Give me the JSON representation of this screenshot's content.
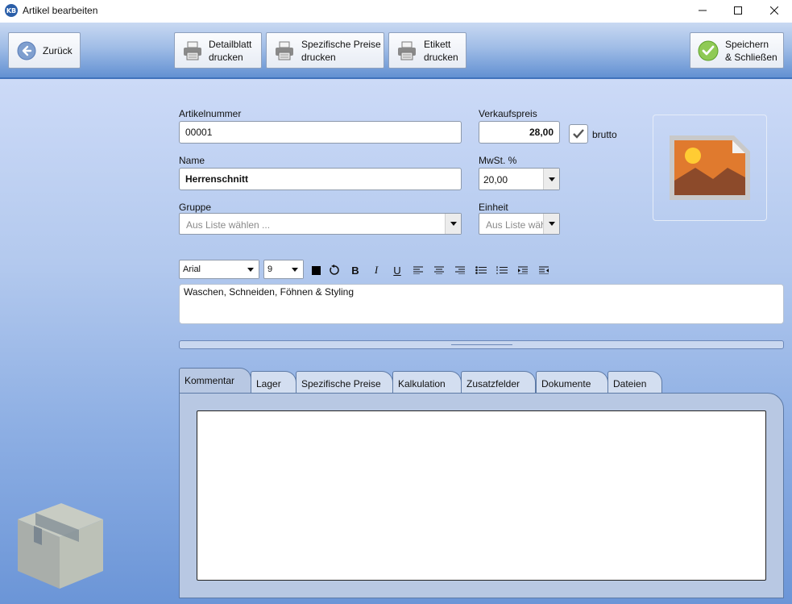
{
  "window": {
    "title": "Artikel bearbeiten",
    "app_icon": "KB",
    "controls": [
      "minimize-icon",
      "maximize-icon",
      "close-icon"
    ]
  },
  "toolbar": {
    "back_label": "Zurück",
    "print_detail_label": [
      "Detailblatt",
      "drucken"
    ],
    "print_prices_label": [
      "Spezifische Preise",
      "drucken"
    ],
    "print_label_label": [
      "Etikett",
      "drucken"
    ],
    "save_close_label": [
      "Speichern",
      "& Schließen"
    ]
  },
  "form": {
    "article_number": {
      "label": "Artikelnummer",
      "value": "00001"
    },
    "name": {
      "label": "Name",
      "value": "Herrenschnitt"
    },
    "group": {
      "label": "Gruppe",
      "placeholder": "Aus Liste wählen ..."
    },
    "price": {
      "label": "Verkaufspreis",
      "value": "28,00",
      "gross_label": "brutto",
      "gross_checked": true
    },
    "vat": {
      "label": "MwSt. %",
      "value": "20,00"
    },
    "unit": {
      "label": "Einheit",
      "placeholder": "Aus Liste wäh"
    }
  },
  "editor": {
    "font": "Arial",
    "size": "9",
    "text": "Waschen, Schneiden, Föhnen & Styling",
    "bold": "B",
    "italic": "I",
    "underline": "U"
  },
  "tabs": [
    "Kommentar",
    "Lager",
    "Spezifische Preise",
    "Kalkulation",
    "Zusatzfelder",
    "Dokumente",
    "Dateien"
  ],
  "active_tab": 0,
  "colors": {
    "accent_blue": "#5f8ed1",
    "save_check_green": "#7cc242"
  }
}
